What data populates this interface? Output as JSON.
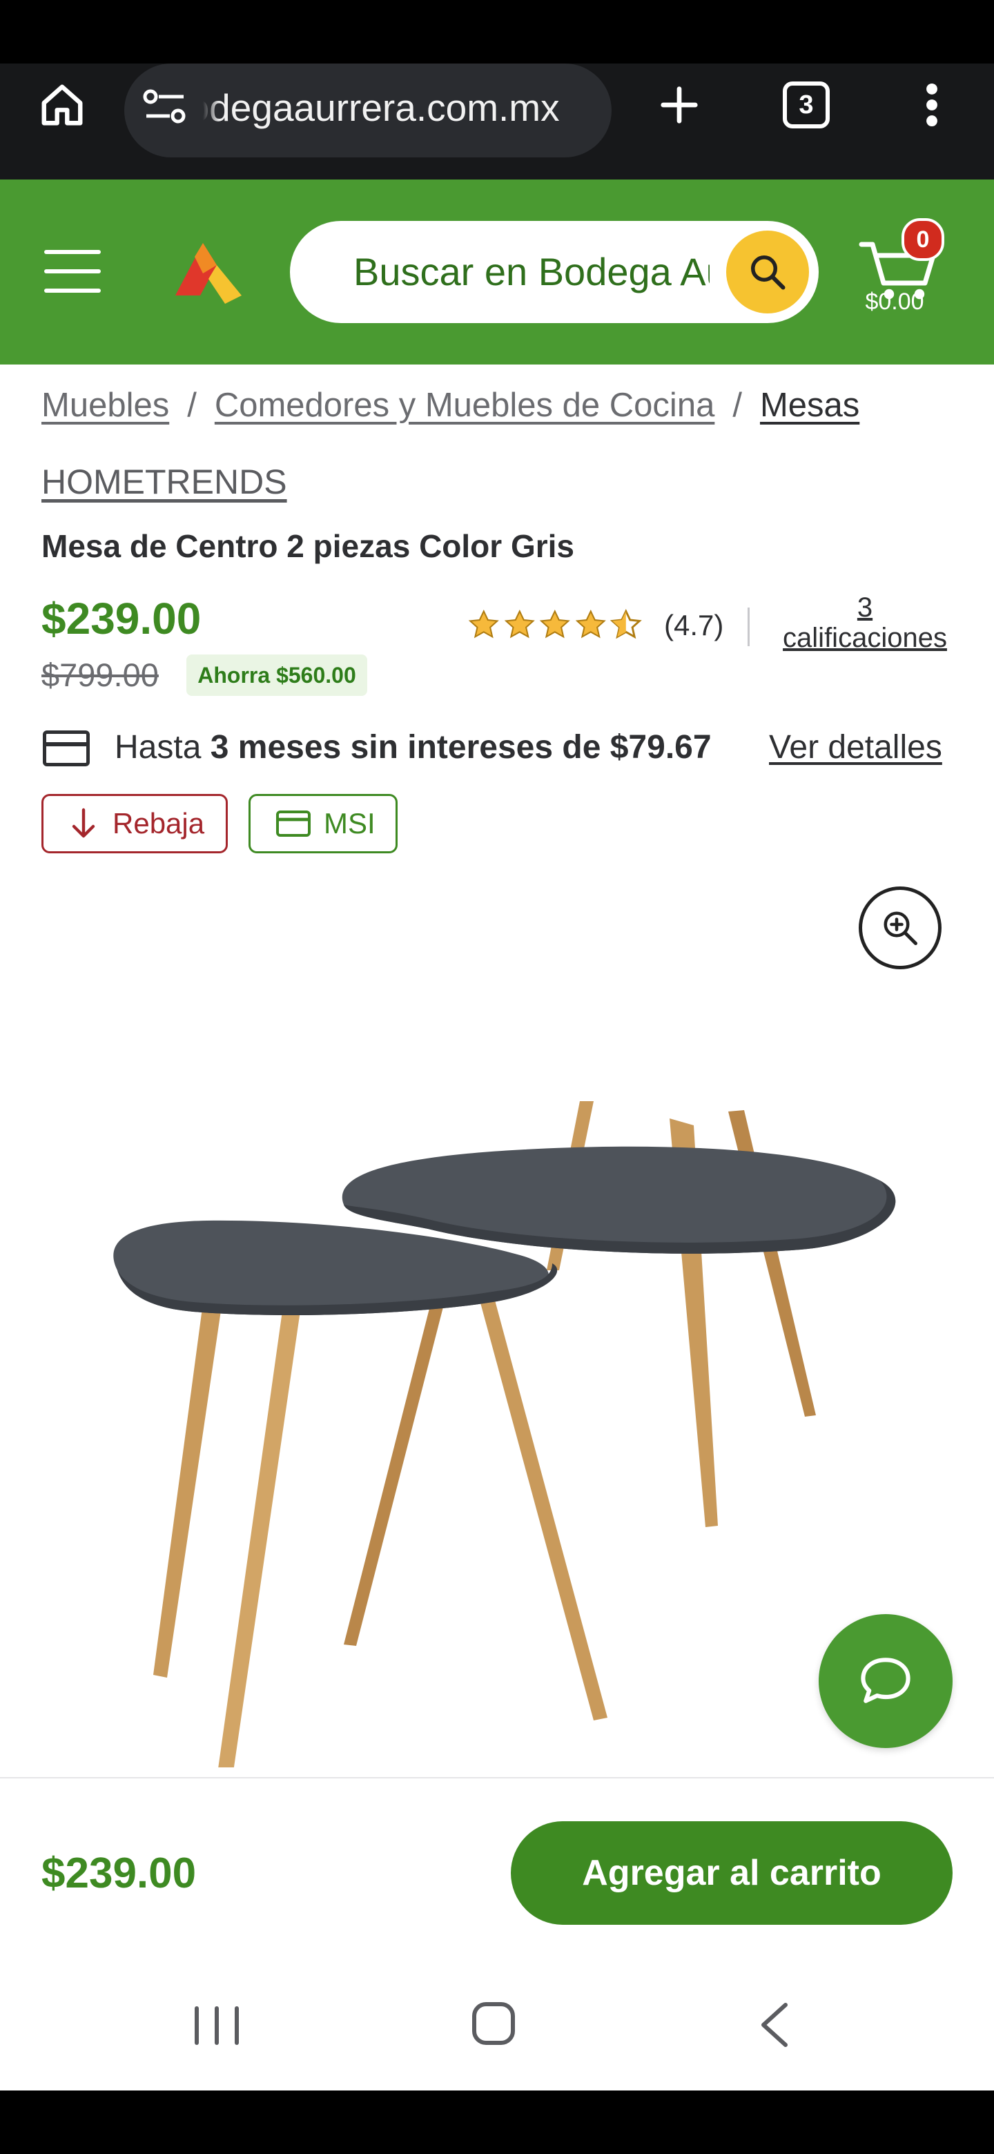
{
  "browser": {
    "url": "bodegaaurrera.com.mx",
    "tab_count": "3"
  },
  "header": {
    "search_placeholder": "Buscar en Bodega Aurrera",
    "cart_count": "0",
    "cart_total": "$0.00",
    "brand_colors": {
      "green": "#4a9a31",
      "yellow": "#f6c330",
      "red": "#d12b1e"
    }
  },
  "breadcrumb": {
    "items": [
      "Muebles",
      "Comedores y Muebles de Cocina",
      "Mesas"
    ],
    "separator": "/"
  },
  "product": {
    "brand": "HOMETRENDS",
    "title": "Mesa de Centro 2 piezas Color Gris",
    "price": "$239.00",
    "old_price": "$799.00",
    "savings": "Ahorra $560.00",
    "rating_value": 4.7,
    "rating_text": "(4.7)",
    "reviews_count": "3",
    "reviews_label": "calificaciones",
    "msi_prefix": "Hasta",
    "msi_bold": "3 meses sin intereses de $79.67",
    "details_link": "Ver detalles",
    "tags": [
      "Rebaja",
      "MSI"
    ]
  },
  "bottom_bar": {
    "price": "$239.00",
    "add_to_cart": "Agregar al carrito"
  }
}
